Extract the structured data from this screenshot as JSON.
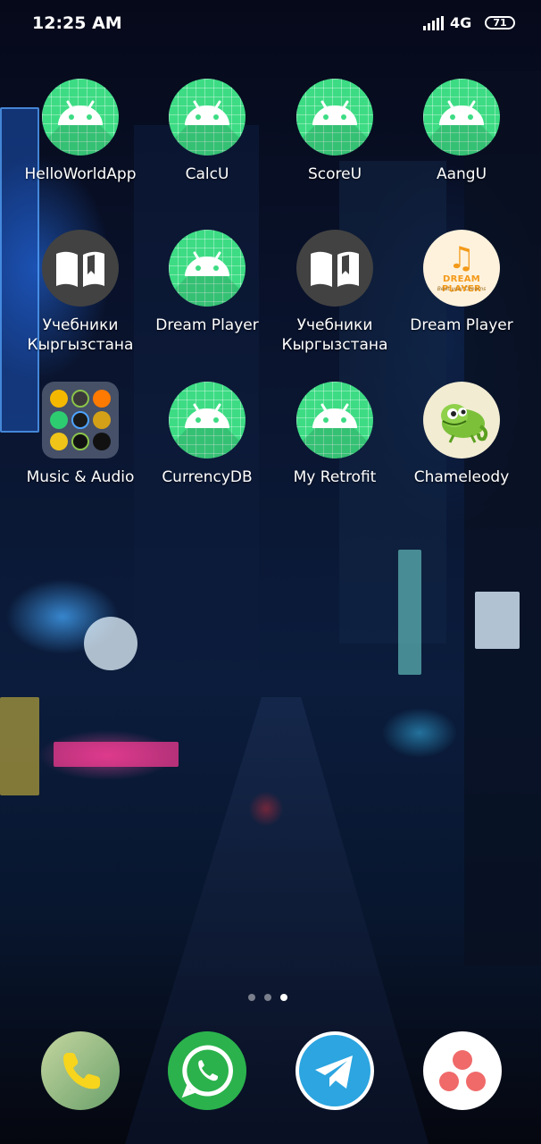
{
  "status_bar": {
    "time": "12:25 AM",
    "network": "4G",
    "battery": "71"
  },
  "apps": [
    {
      "label": "HelloWorldApp",
      "icon": "android-icon"
    },
    {
      "label": "CalcU",
      "icon": "android-icon"
    },
    {
      "label": "ScoreU",
      "icon": "android-icon"
    },
    {
      "label": "AangU",
      "icon": "android-icon"
    },
    {
      "label_line1": "Учебники",
      "label_line2": "Кыргызстана",
      "icon": "book-icon"
    },
    {
      "label": "Dream Player",
      "icon": "android-icon"
    },
    {
      "label_line1": "Учебники",
      "label_line2": "Кыргызстана",
      "icon": "book-icon"
    },
    {
      "label": "Dream Player",
      "icon": "dream-player-logo",
      "logo_title": "DREAM PLAYER",
      "logo_subtitle": "Beat your Dreams"
    },
    {
      "label": "Music & Audio",
      "icon": "folder-icon"
    },
    {
      "label": "CurrencyDB",
      "icon": "android-icon"
    },
    {
      "label": "My Retrofit",
      "icon": "android-icon"
    },
    {
      "label": "Chameleody",
      "icon": "chameleon-icon"
    }
  ],
  "page_indicator": {
    "count": 3,
    "active": 3
  },
  "dock": [
    {
      "name": "Phone",
      "icon": "phone-icon",
      "color": "#f7d51d"
    },
    {
      "name": "WhatsApp",
      "icon": "whatsapp-icon",
      "color": "#25d366"
    },
    {
      "name": "Telegram",
      "icon": "telegram-icon",
      "color": "#2ca5e0"
    },
    {
      "name": "Asana",
      "icon": "asana-icon",
      "color": "#f06a6a"
    }
  ],
  "colors": {
    "android_green": "#3ddc84",
    "book_gray": "#424242",
    "dream_orange": "#f39a1a"
  }
}
